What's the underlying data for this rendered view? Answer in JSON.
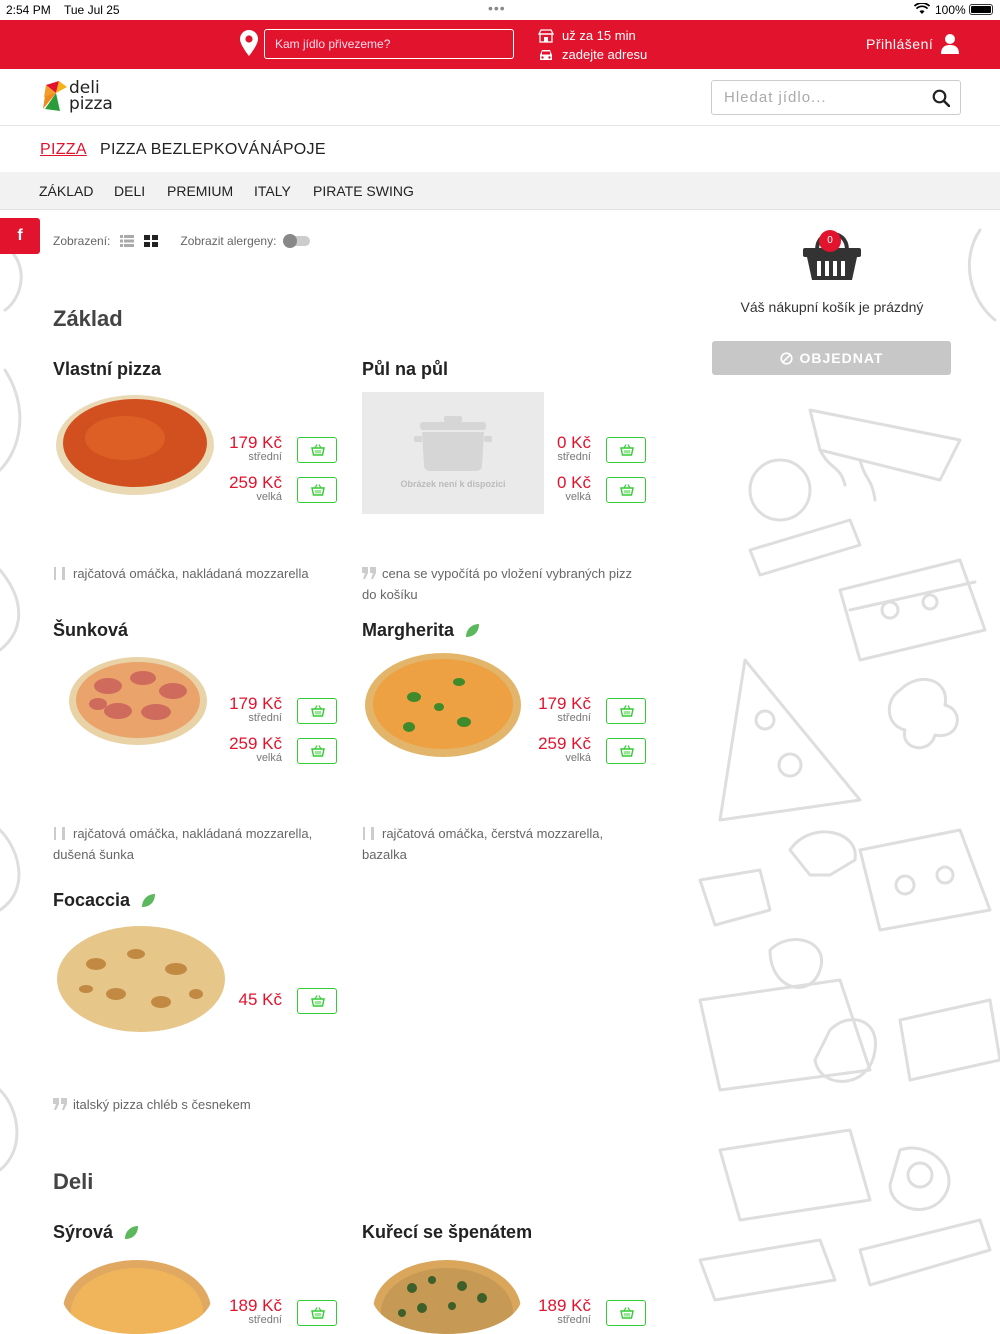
{
  "status": {
    "time": "2:54 PM",
    "date": "Tue Jul 25",
    "dots": "•••",
    "battery": "100%"
  },
  "topbar": {
    "address_placeholder": "Kam jídlo přivezeme?",
    "delivery_time": "už za 15 min",
    "delivery_address": "zadejte adresu",
    "login": "Přihlášení"
  },
  "header": {
    "logo_line1": "deli",
    "logo_line2": "pizza",
    "search_placeholder": "Hledat jídlo..."
  },
  "main_nav": [
    "PIZZA",
    "PIZZA BEZLEPKOVÁ",
    "NÁPOJE"
  ],
  "sub_nav": [
    "ZÁKLAD",
    "DELI",
    "PREMIUM",
    "ITALY",
    "PIRATE SWING"
  ],
  "social": {
    "facebook": "f"
  },
  "view": {
    "label": "Zobrazení:",
    "allergen_label": "Zobrazit alergeny:"
  },
  "sections": {
    "zaklad": "Základ",
    "deli": "Deli"
  },
  "products": {
    "vlastni": {
      "name": "Vlastní pizza",
      "price_m": "179 Kč",
      "size_m": "střední",
      "price_l": "259 Kč",
      "size_l": "velká",
      "desc": "rajčatová omáčka, nakládaná mozzarella"
    },
    "pulnapul": {
      "name": "Půl na půl",
      "no_image": "Obrázek není k dispozici",
      "price_m": "0 Kč",
      "size_m": "střední",
      "price_l": "0 Kč",
      "size_l": "velká",
      "desc_1": "cena se vypočítá po vložení vybraných pizz",
      "desc_2": "do košíku"
    },
    "sunkova": {
      "name": "Šunková",
      "price_m": "179 Kč",
      "size_m": "střední",
      "price_l": "259 Kč",
      "size_l": "velká",
      "desc_1": "rajčatová omáčka, nakládaná mozzarella,",
      "desc_2": "dušená šunka"
    },
    "margherita": {
      "name": "Margherita",
      "price_m": "179 Kč",
      "size_m": "střední",
      "price_l": "259 Kč",
      "size_l": "velká",
      "desc_1": "rajčatová omáčka, čerstvá mozzarella,",
      "desc_2": "bazalka"
    },
    "focaccia": {
      "name": "Focaccia",
      "price": "45 Kč",
      "desc": "italský pizza chléb s česnekem"
    },
    "syrova": {
      "name": "Sýrová",
      "price_m": "189 Kč",
      "size_m": "střední"
    },
    "kureci": {
      "name": "Kuřecí se špenátem",
      "price_m": "189 Kč",
      "size_m": "střední"
    }
  },
  "basket": {
    "count": "0",
    "empty": "Váš nákupní košík je prázdný",
    "order": "OBJEDNAT"
  },
  "colors": {
    "brand_red": "#e2132d",
    "cart_green": "#33cc33",
    "disabled": "#c7c7c7"
  }
}
